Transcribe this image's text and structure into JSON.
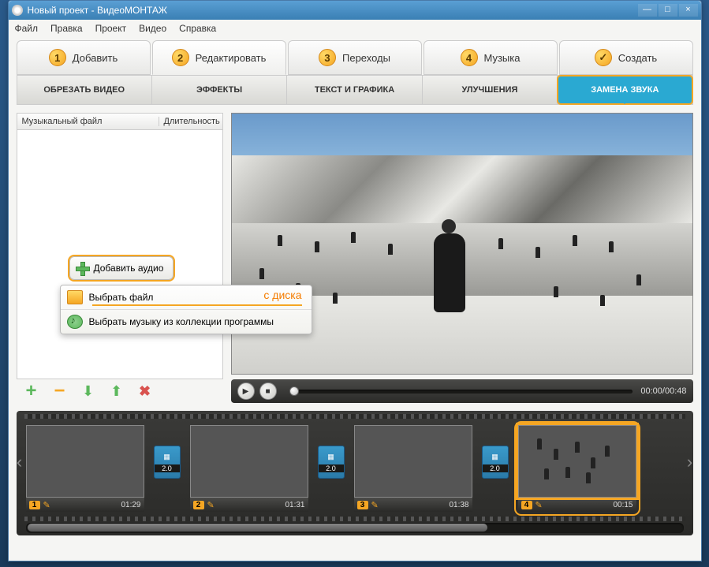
{
  "window": {
    "title": "Новый проект - ВидеоМОНТАЖ"
  },
  "menu": {
    "file": "Файл",
    "edit": "Правка",
    "project": "Проект",
    "video": "Видео",
    "help": "Справка"
  },
  "wizard": {
    "step1": "Добавить",
    "step2": "Редактировать",
    "step3": "Переходы",
    "step4": "Музыка",
    "step5": "Создать"
  },
  "subtabs": {
    "trim": "ОБРЕЗАТЬ ВИДЕО",
    "effects": "ЭФФЕКТЫ",
    "text": "ТЕКСТ И ГРАФИКА",
    "enhance": "УЛУЧШЕНИЯ",
    "audio": "ЗАМЕНА ЗВУКА"
  },
  "list": {
    "col_file": "Музыкальный файл",
    "col_duration": "Длительность",
    "add_audio": "Добавить аудио"
  },
  "dropdown": {
    "from_file": "Выбрать файл",
    "from_collection": "Выбрать музыку из коллекции программы",
    "disk_hint": "с диска"
  },
  "player": {
    "time_current": "00:00",
    "time_sep": " / ",
    "time_total": "00:48"
  },
  "timeline": {
    "trans_dur": "2.0",
    "clips": [
      {
        "index": "1",
        "duration": "01:29"
      },
      {
        "index": "2",
        "duration": "01:31"
      },
      {
        "index": "3",
        "duration": "01:38"
      },
      {
        "index": "4",
        "duration": "00:15"
      }
    ]
  }
}
